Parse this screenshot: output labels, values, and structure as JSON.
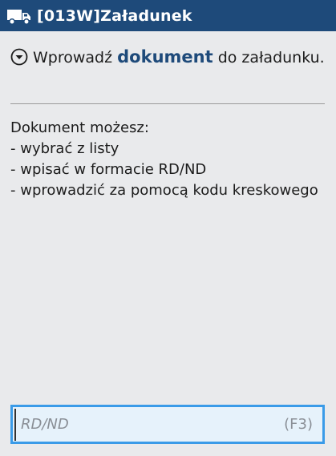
{
  "header": {
    "title": "[013W]Załadunek",
    "icon": "truck-icon",
    "background": "#1e4a7a"
  },
  "instruction": {
    "icon": "chevron-down-circle-icon",
    "prefix": "Wprowadź",
    "keyword": "dokument",
    "suffix": "do załadunku."
  },
  "help": {
    "intro": "Dokument możesz:",
    "items": [
      "- wybrać z listy",
      "- wpisać w formacie RD/ND",
      "- wprowadzić za pomocą kodu kreskowego"
    ]
  },
  "document_input": {
    "placeholder": "RD/ND",
    "value": "",
    "shortcut": "(F3)",
    "border_color": "#3a9be8"
  }
}
